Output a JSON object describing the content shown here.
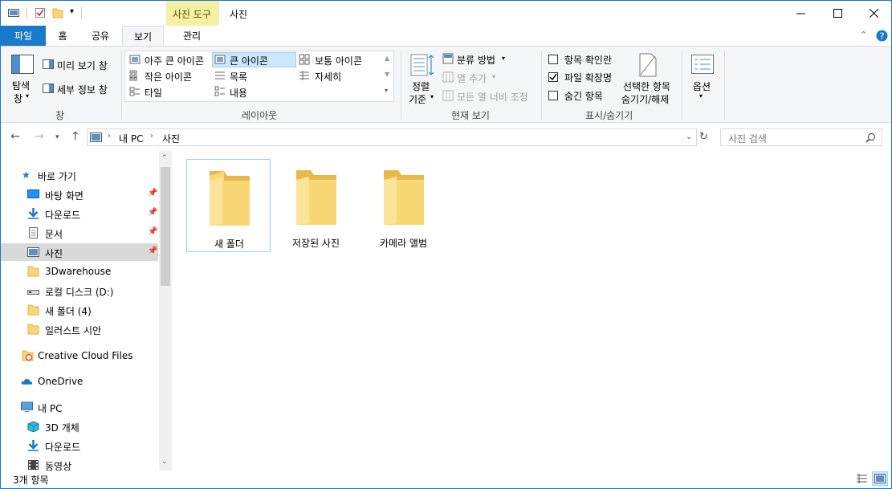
{
  "titlebar": {
    "contextual_tab": "사진 도구",
    "title": "사진",
    "minimize": "—",
    "maximize": "☐",
    "close": "✕"
  },
  "tabs": {
    "file": "파일",
    "home": "홈",
    "share": "공유",
    "view": "보기",
    "manage": "관리"
  },
  "ribbon": {
    "panes": {
      "nav_pane_line1": "탐색",
      "nav_pane_line2": "창",
      "preview_pane": "미리 보기 창",
      "details_pane": "세부 정보 창",
      "group_label": "창"
    },
    "layout": {
      "items": [
        "아주 큰 아이콘",
        "큰 아이콘",
        "보통 아이콘",
        "작은 아이콘",
        "목록",
        "자세히",
        "타일",
        "내용"
      ],
      "group_label": "레이아웃"
    },
    "current_view": {
      "sort_line1": "정렬",
      "sort_line2": "기준",
      "group_by": "분류 방법",
      "add_columns": "열 추가",
      "fit_columns": "모든 열 너비 조정",
      "group_label": "현재 보기"
    },
    "show_hide": {
      "item_checkboxes": "항목 확인란",
      "file_extensions": "파일 확장명",
      "hidden_items": "숨긴 항목",
      "hide_selected_line1": "선택한 항목",
      "hide_selected_line2": "숨기기/해제",
      "group_label": "표시/숨기기",
      "checked": {
        "item_checkboxes": false,
        "file_extensions": true,
        "hidden_items": false
      }
    },
    "options": {
      "label": "옵션"
    }
  },
  "address": {
    "crumbs": [
      "내 PC",
      "사진"
    ],
    "search_placeholder": "사진 검색"
  },
  "navpane": {
    "quick_access": "바로 가기",
    "items": [
      {
        "label": "바탕 화면",
        "pinned": true
      },
      {
        "label": "다운로드",
        "pinned": true
      },
      {
        "label": "문서",
        "pinned": true
      },
      {
        "label": "사진",
        "pinned": true
      },
      {
        "label": "3Dwarehouse"
      },
      {
        "label": "로컬 디스크 (D:)"
      },
      {
        "label": "새 폴더 (4)"
      },
      {
        "label": "일러스트 시안"
      }
    ],
    "creative_cloud": "Creative Cloud Files",
    "onedrive": "OneDrive",
    "this_pc": "내 PC",
    "pc_items": [
      "3D 개체",
      "다운로드",
      "동영상"
    ]
  },
  "folders": [
    "새 폴더",
    "저장된 사진",
    "카메라 앨범"
  ],
  "status": {
    "count": "3개 항목"
  },
  "colors": {
    "accent": "#1979ca",
    "context_tab": "#f6f0a4",
    "selection": "#cce8ff",
    "folder": "#f8d775"
  }
}
